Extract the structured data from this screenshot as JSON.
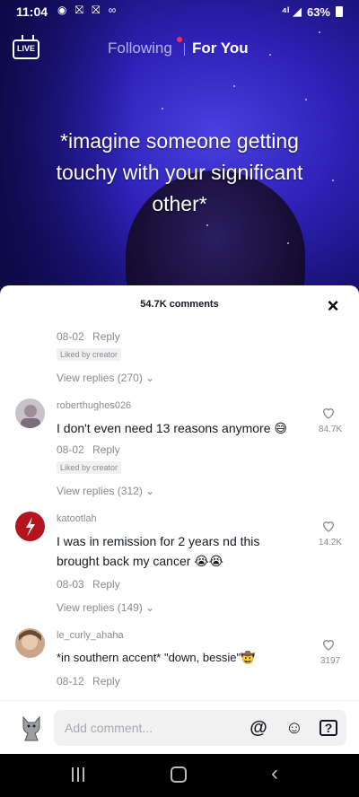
{
  "status_bar": {
    "time": "11:04",
    "left_icons": "◉ ⛝ ⛝ ∞",
    "signal": "⁴ᴵ ◢",
    "battery": "63%"
  },
  "top_nav": {
    "live_label": "LIVE",
    "tab_following": "Following",
    "tab_for_you": "For You"
  },
  "video": {
    "caption_line1": "*imagine someone getting",
    "caption_line2": "touchy with your significant",
    "caption_line3": "other*"
  },
  "comments_sheet": {
    "count_label": "54.7K comments",
    "close_glyph": "×",
    "partial_comment": {
      "date": "08-02",
      "reply_label": "Reply",
      "liked_by_creator": "Liked by creator",
      "view_replies": "View replies (270)"
    },
    "comments": [
      {
        "username": "roberthughes026",
        "text": "I don't even need 13 reasons anymore 😅",
        "likes": "84.7K",
        "date": "08-02",
        "reply_label": "Reply",
        "liked_by_creator": "Liked by creator",
        "view_replies": "View replies (312)"
      },
      {
        "username": "katootlah",
        "text": "I was in remission for 2 years nd this brought back my cancer 😭😭",
        "likes": "14.2K",
        "date": "08-03",
        "reply_label": "Reply",
        "view_replies": "View replies (149)"
      },
      {
        "username": "le_curly_ahaha",
        "text": "*in southern accent* \"down, bessie\"🤠",
        "likes": "3197",
        "date": "08-12",
        "reply_label": "Reply"
      }
    ]
  },
  "comment_input": {
    "placeholder": "Add comment...",
    "mention_glyph": "@",
    "emoji_glyph": "☺",
    "question_glyph": "?"
  },
  "colors": {
    "accent": "#fe2c55",
    "muted_text": "#8a8b91",
    "primary_text": "#161823"
  }
}
